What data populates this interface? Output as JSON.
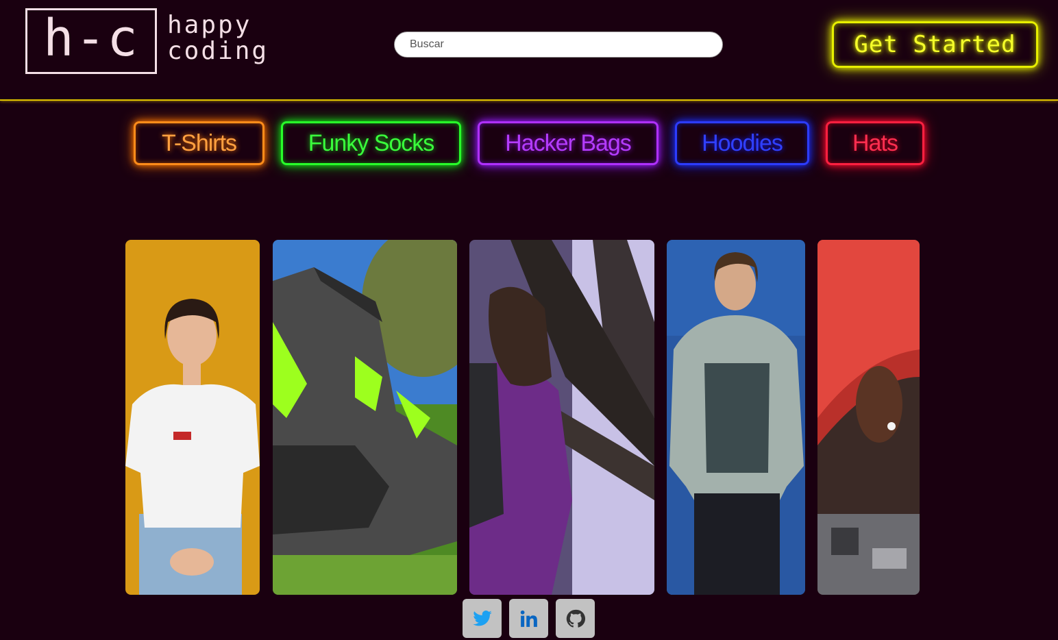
{
  "brand": {
    "mark": "h-c",
    "line1": "happy",
    "line2": "coding"
  },
  "search": {
    "placeholder": "Buscar",
    "value": ""
  },
  "header": {
    "cta_label": "Get Started"
  },
  "categories": [
    {
      "label": "T-Shirts",
      "color": "#ff8c1a"
    },
    {
      "label": "Funky Socks",
      "color": "#28ff2a"
    },
    {
      "label": "Hacker Bags",
      "color": "#b030ff"
    },
    {
      "label": "Hoodies",
      "color": "#2c3cff"
    },
    {
      "label": "Hats",
      "color": "#ff2040"
    }
  ],
  "gallery": [
    {
      "subject": "woman-white-tshirt-photo"
    },
    {
      "subject": "funky-socks-photo"
    },
    {
      "subject": "hiker-backpack-waterfall-photo"
    },
    {
      "subject": "man-grey-hoodie-photo"
    },
    {
      "subject": "red-cap-photo"
    }
  ],
  "social": [
    {
      "icon": "twitter-icon",
      "color": "#1da1f2"
    },
    {
      "icon": "linkedin-icon",
      "color": "#0a66c2"
    },
    {
      "icon": "github-icon",
      "color": "#333333"
    }
  ],
  "theme": {
    "background": "#1a0010",
    "header_rule": "#e2c400",
    "cta": "#e8f000"
  }
}
